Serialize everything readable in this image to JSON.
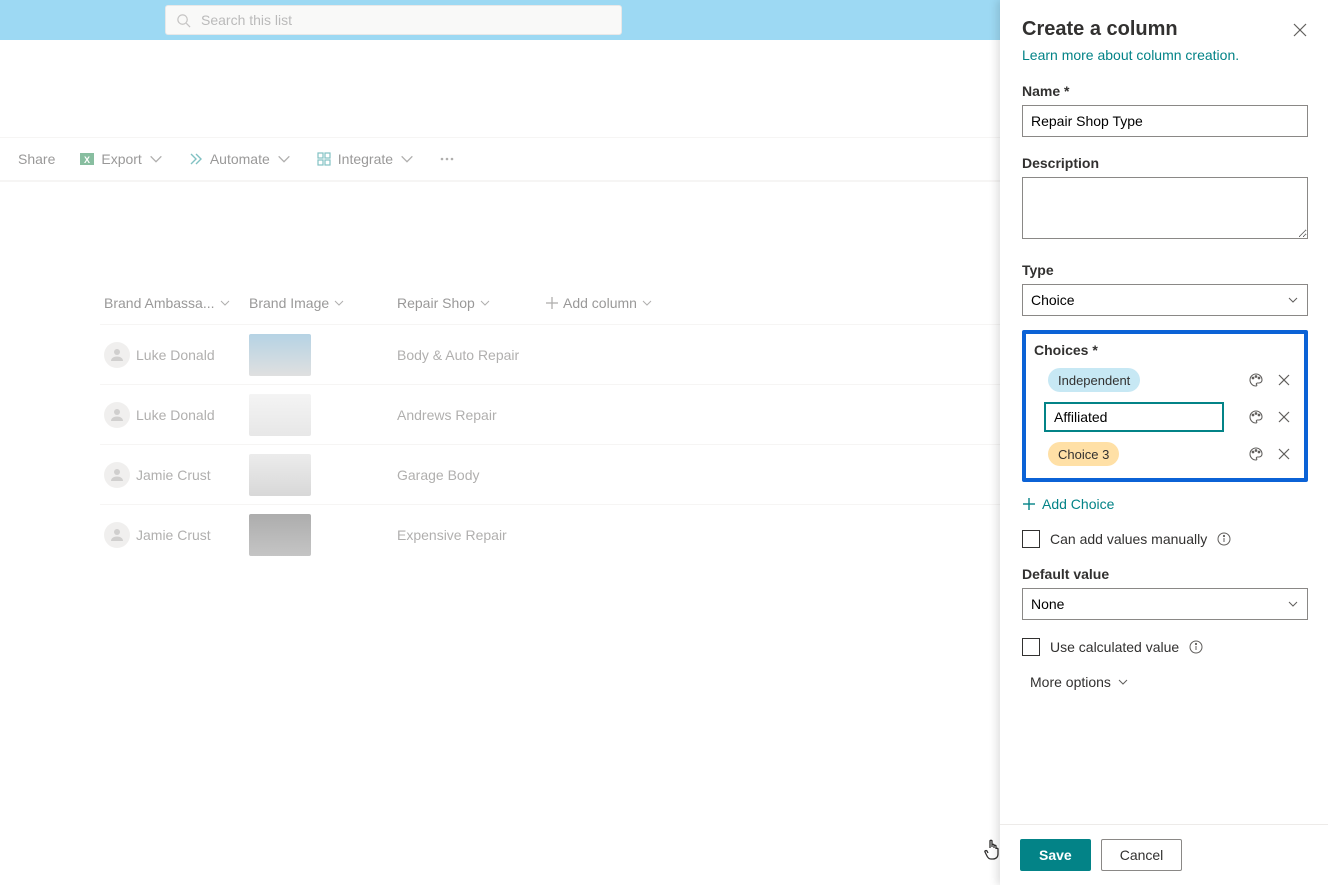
{
  "search": {
    "placeholder": "Search this list"
  },
  "commandbar": {
    "share": "Share",
    "export": "Export",
    "automate": "Automate",
    "integrate": "Integrate"
  },
  "columns": {
    "brandAmb": "Brand Ambassa...",
    "brandImg": "Brand Image",
    "repairShop": "Repair Shop",
    "addCol": "Add column"
  },
  "rows": [
    {
      "amb": "Luke Donald",
      "shop": "Body & Auto Repair"
    },
    {
      "amb": "Luke Donald",
      "shop": "Andrews Repair"
    },
    {
      "amb": "Jamie Crust",
      "shop": "Garage Body"
    },
    {
      "amb": "Jamie Crust",
      "shop": "Expensive Repair"
    }
  ],
  "panel": {
    "title": "Create a column",
    "learn": "Learn more about column creation.",
    "nameLabel": "Name *",
    "nameValue": "Repair Shop Type",
    "descLabel": "Description",
    "typeLabel": "Type",
    "typeValue": "Choice",
    "choicesLabel": "Choices *",
    "choice1": "Independent",
    "choice2Value": "Affiliated",
    "choice3": "Choice 3",
    "addChoice": "Add Choice",
    "manualLabel": "Can add values manually",
    "defaultLabel": "Default value",
    "defaultValue": "None",
    "calcLabel": "Use calculated value",
    "moreOpts": "More options",
    "save": "Save",
    "cancel": "Cancel"
  }
}
